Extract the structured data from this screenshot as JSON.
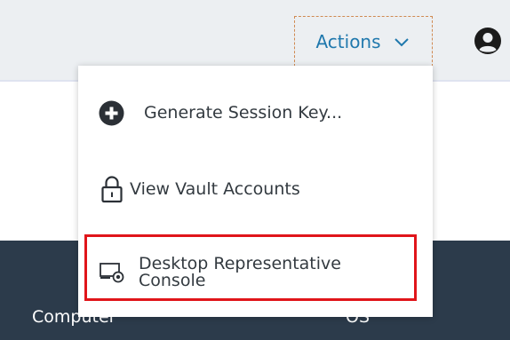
{
  "header": {
    "actions_label": "Actions",
    "actions_icon": "chevron-down-icon",
    "user_icon": "user-circle-icon"
  },
  "menu": {
    "items": [
      {
        "label": "Generate Session Key...",
        "icon": "plus-circle-icon"
      },
      {
        "label": "View Vault Accounts",
        "icon": "lock-icon"
      },
      {
        "label": "Desktop Representative\nConsole",
        "icon": "desktop-console-icon",
        "highlighted": true
      }
    ]
  },
  "table": {
    "columns": [
      "Computer",
      "OS"
    ]
  },
  "colors": {
    "accent": "#1f78ad",
    "highlight": "#e0151a",
    "table_header_bg": "#2c3b4b",
    "topbar_bg": "#eceff2"
  }
}
